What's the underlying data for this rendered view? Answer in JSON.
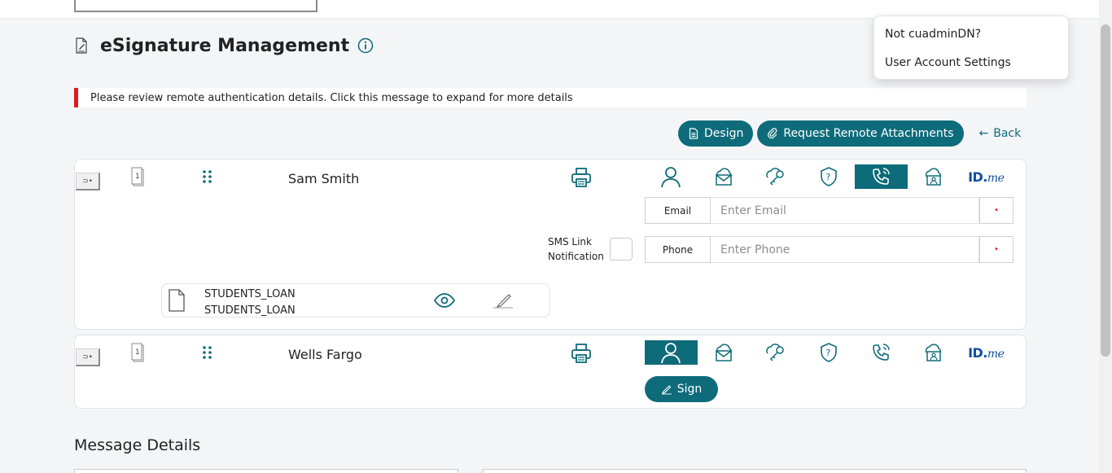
{
  "page": {
    "title": "eSignature Management"
  },
  "alert": {
    "text": "Please review remote authentication details. Click this message to expand for more details"
  },
  "toolbar": {
    "design_label": "Design",
    "request_label": "Request Remote Attachments",
    "back_label": "Back"
  },
  "user_menu": {
    "items": [
      {
        "label": "Not cuadminDN?"
      },
      {
        "label": "User Account Settings"
      }
    ]
  },
  "signers": [
    {
      "name": "Sam Smith",
      "page_count": "1",
      "expand_label": "⊃•",
      "active_auth": "phone-auth",
      "email_label": "Email",
      "email_placeholder": "Enter Email",
      "phone_label": "Phone",
      "phone_placeholder": "Enter Phone",
      "required_mark": "•",
      "sms_label_line1": "SMS Link",
      "sms_label_line2": "Notification",
      "documents": [
        {
          "line1": "STUDENTS_LOAN",
          "line2": "STUDENTS_LOAN"
        }
      ]
    },
    {
      "name": "Wells Fargo",
      "page_count": "1",
      "expand_label": "⊃•",
      "active_auth": "in-person-auth",
      "sign_label": "Sign"
    }
  ],
  "idme": {
    "bold": "ID.",
    "italic": "me"
  },
  "message_details": {
    "title": "Message Details"
  },
  "colors": {
    "accent": "#0e6b7a",
    "alert": "#e0181f",
    "idme": "#0e4f9e"
  },
  "icons": [
    "document-signature-icon",
    "info-icon",
    "design-doc-icon",
    "paperclip-icon",
    "arrow-left-icon",
    "page-count-icon",
    "drag-handle-icon",
    "printer-icon",
    "person-icon",
    "cloud-mail-icon",
    "cloud-key-icon",
    "shield-question-icon",
    "phone-icon",
    "cloud-id-card-icon",
    "file-icon",
    "eye-icon",
    "signature-pen-icon"
  ]
}
